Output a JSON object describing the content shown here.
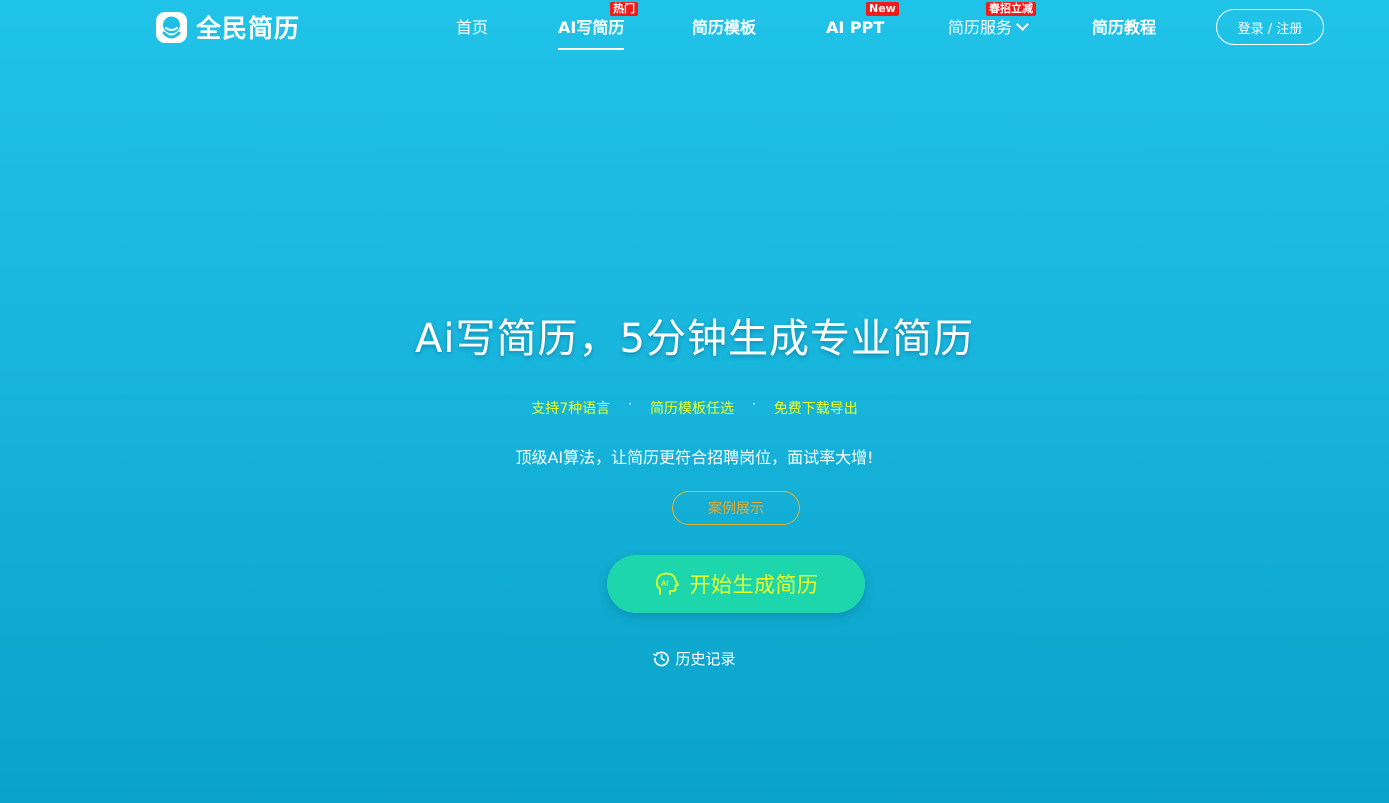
{
  "brand": {
    "name": "全民简历"
  },
  "nav": {
    "home": "首页",
    "ai_resume": "AI写简历",
    "ai_resume_badge": "热门",
    "templates": "简历模板",
    "ai_ppt": "AI PPT",
    "ai_ppt_badge": "New",
    "services": "简历服务",
    "services_badge": "春招立减",
    "tutorials": "简历教程",
    "login": "登录 / 注册"
  },
  "hero": {
    "title": "Ai写简历，5分钟生成专业简历",
    "features": [
      "支持7种语言",
      "简历模板任选",
      "免费下载导出"
    ],
    "feature_separator": "·",
    "subline": "顶级AI算法，让简历更符合招聘岗位，面试率大增!",
    "case_label": "案例展示",
    "start_label": "开始生成简历",
    "history_label": "历史记录"
  },
  "colors": {
    "bg_top": "#20c3e8",
    "bg_bottom": "#0aa2c9",
    "accent_yellow": "#eaff27",
    "start_button": "#1ed6ab",
    "badge_red": "#f01c1c",
    "case_border": "#e0b22e"
  },
  "icons": {
    "logo": "resume-face-logo",
    "services_dropdown": "chevron-down-icon",
    "start_button": "ai-head-icon",
    "history": "history-clock-icon"
  }
}
